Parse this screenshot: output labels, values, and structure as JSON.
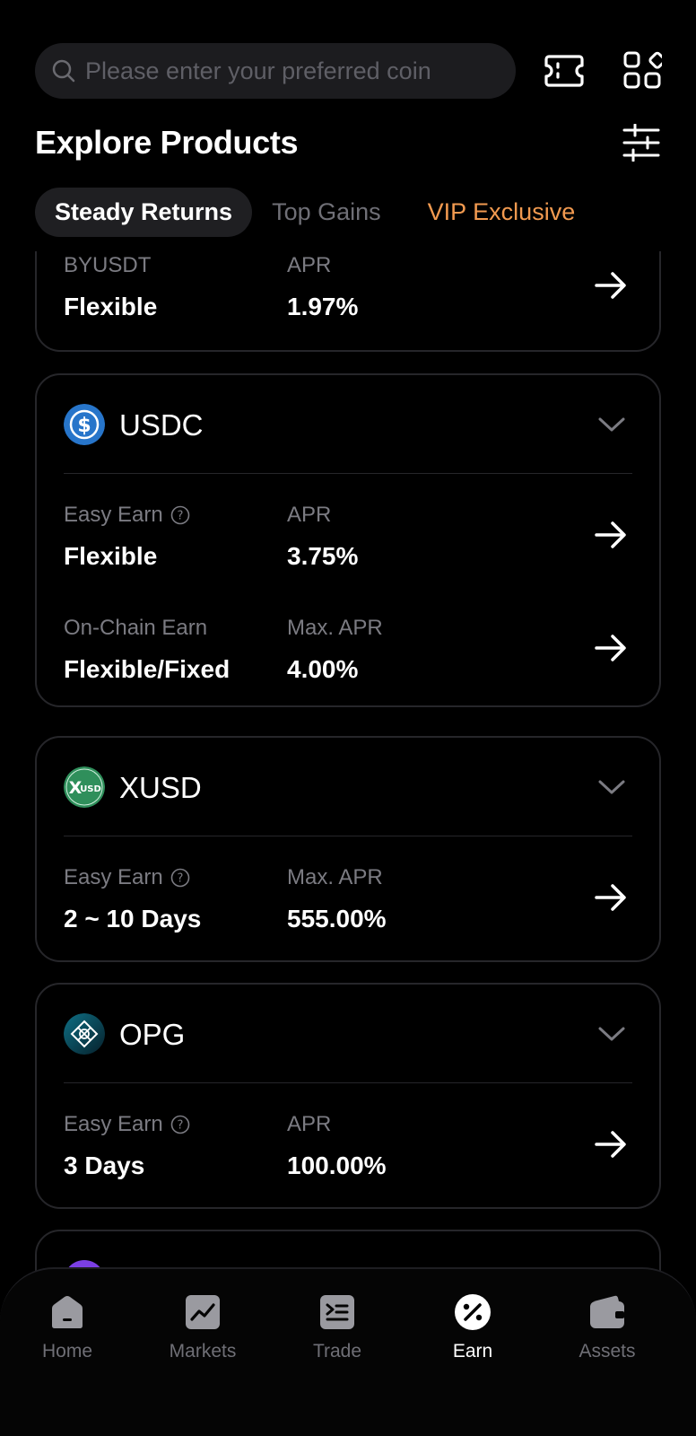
{
  "search": {
    "placeholder": "Please enter your preferred coin"
  },
  "header": {
    "title": "Explore Products"
  },
  "tabs": [
    {
      "label": "Steady Returns",
      "active": true
    },
    {
      "label": "Top Gains",
      "active": false
    },
    {
      "label": "VIP Exclusive",
      "active": false,
      "color": "#f29a50"
    }
  ],
  "partial_card": {
    "label1": "BYUSDT",
    "value1": "Flexible",
    "label2": "APR",
    "value2": "1.97%"
  },
  "cards": [
    {
      "coin": "USDC",
      "logo_color": "#2775ca",
      "rows": [
        {
          "product": "Easy Earn",
          "term": "Flexible",
          "rate_label": "APR",
          "rate": "3.75%"
        },
        {
          "product": "On-Chain Earn",
          "term": "Flexible/Fixed",
          "rate_label": "Max. APR",
          "rate": "4.00%"
        }
      ]
    },
    {
      "coin": "XUSD",
      "logo_color": "#2f8f5b",
      "logo_text": "XUSD",
      "rows": [
        {
          "product": "Easy Earn",
          "term": "2 ~ 10 Days",
          "rate_label": "Max. APR",
          "rate": "555.00%"
        }
      ]
    },
    {
      "coin": "OPG",
      "logo_color": "#0e5f73",
      "rows": [
        {
          "product": "Easy Earn",
          "term": "3 Days",
          "rate_label": "APR",
          "rate": "100.00%"
        }
      ]
    }
  ],
  "nav": [
    {
      "label": "Home",
      "icon": "home-icon",
      "active": false
    },
    {
      "label": "Markets",
      "icon": "markets-icon",
      "active": false
    },
    {
      "label": "Trade",
      "icon": "trade-icon",
      "active": false
    },
    {
      "label": "Earn",
      "icon": "earn-icon",
      "active": true
    },
    {
      "label": "Assets",
      "icon": "assets-icon",
      "active": false
    }
  ]
}
